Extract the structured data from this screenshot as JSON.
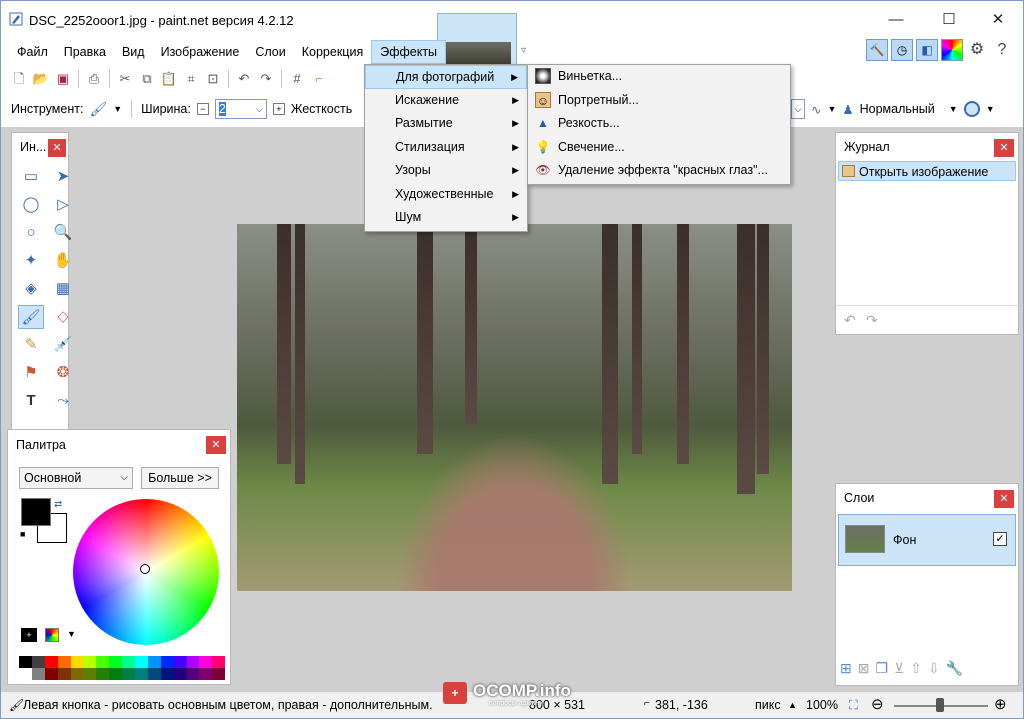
{
  "window": {
    "title": "DSC_2252ooor1.jpg - paint.net версия 4.2.12",
    "controls": {
      "minimize": "—",
      "maximize": "☐",
      "close": "✕"
    }
  },
  "menubar": [
    "Файл",
    "Правка",
    "Вид",
    "Изображение",
    "Слои",
    "Коррекция",
    "Эффекты"
  ],
  "toolbar2": {
    "tool_label": "Инструмент:",
    "width_label": "Ширина:",
    "width_value": "2",
    "hardness_label": "Жесткость",
    "blend_mode": "Нормальный"
  },
  "effects_menu": {
    "items": [
      "Для фотографий",
      "Искажение",
      "Размытие",
      "Стилизация",
      "Узоры",
      "Художественные",
      "Шум"
    ]
  },
  "photo_submenu": {
    "items": [
      {
        "label": "Виньетка...",
        "icon": "vignette-icon"
      },
      {
        "label": "Портретный...",
        "icon": "portrait-icon"
      },
      {
        "label": "Резкость...",
        "icon": "sharpen-icon"
      },
      {
        "label": "Свечение...",
        "icon": "glow-icon"
      },
      {
        "label": "Удаление эффекта \"красных глаз\"...",
        "icon": "red-eye-icon"
      }
    ]
  },
  "tools_panel": {
    "title": "Ин..."
  },
  "palette": {
    "title": "Палитра",
    "mode": "Основной",
    "more_button": "Больше >>",
    "primary_color": "#000000",
    "secondary_color": "#ffffff",
    "swatches_row1": [
      "#000000",
      "#404040",
      "#ff0000",
      "#ff6a00",
      "#ffd800",
      "#b6ff00",
      "#4cff00",
      "#00ff21",
      "#00ff90",
      "#00ffff",
      "#0094ff",
      "#0026ff",
      "#4800ff",
      "#b200ff",
      "#ff00dc",
      "#ff006e"
    ],
    "swatches_row2": [
      "#ffffff",
      "#808080",
      "#7f0000",
      "#7f3300",
      "#7f6a00",
      "#5b7f00",
      "#267f00",
      "#007f0e",
      "#007f46",
      "#007f7f",
      "#004a7f",
      "#00137f",
      "#21007f",
      "#57007f",
      "#7f006e",
      "#7f0037"
    ]
  },
  "journal": {
    "title": "Журнал",
    "items": [
      "Открыть изображение"
    ]
  },
  "layers": {
    "title": "Слои",
    "items": [
      {
        "name": "Фон",
        "visible": true
      }
    ]
  },
  "statusbar": {
    "hint": "Левая кнопка - рисовать основным цветом, правая - дополнительным.",
    "size": "800 × 531",
    "cursor": "381, -136",
    "units": "пикс",
    "zoom": "100%"
  },
  "watermark": {
    "badge": "+",
    "text": "OCOMP.info",
    "subtext": "вопросы админу"
  }
}
